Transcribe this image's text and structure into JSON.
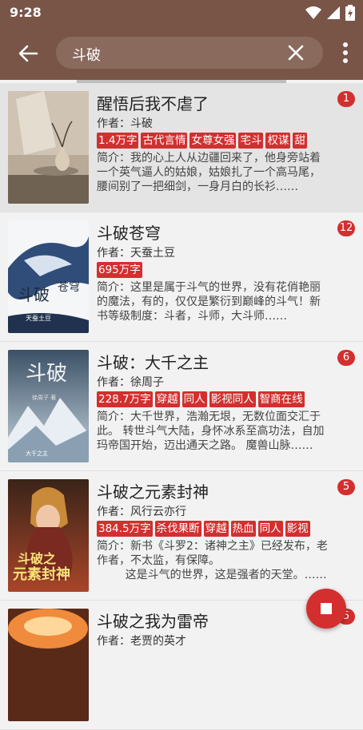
{
  "status": {
    "time": "9:28"
  },
  "search": {
    "query": "斗破"
  },
  "books": [
    {
      "title": "醒悟后我不虐了",
      "author": "作者：斗破",
      "badge": "1",
      "tags": [
        "1.4万字",
        "古代言情",
        "女尊女强",
        "宅斗",
        "权谋",
        "甜"
      ],
      "intro": "简介：我的心上人从边疆回来了，他身旁站着一个英气逼人的姑娘，姑娘扎了一个高马尾，腰间别了一把细剑，一身月白的长衫……"
    },
    {
      "title": "斗破苍穹",
      "author": "作者：天蚕土豆",
      "badge": "12",
      "tags": [
        "695万字"
      ],
      "intro": "简介：这里是属于斗气的世界，没有花俏艳丽的魔法，有的，仅仅是繁衍到巅峰的斗气！新书等级制度：斗者，斗师，大斗师……"
    },
    {
      "title": "斗破：大千之主",
      "author": "作者：徐周子",
      "badge": "6",
      "tags": [
        "228.7万字",
        "穿越",
        "同人",
        "影视同人",
        "智商在线"
      ],
      "intro": "简介：大千世界，浩瀚无垠，无数位面交汇于此。 转世斗气大陆，身怀冰系至高功法，自加玛帝国开始，迈出通天之路。 魔兽山脉……"
    },
    {
      "title": "斗破之元素封神",
      "author": "作者：风行云亦行",
      "badge": "5",
      "tags": [
        "384.5万字",
        "杀伐果断",
        "穿越",
        "热血",
        "同人",
        "影视"
      ],
      "intro": "简介：新书《斗罗2：诸神之主》已经发布，老作者，不太监，有保障。\n        这是斗气的世界，这是强者的天堂。……"
    },
    {
      "title": "斗破之我为雷帝",
      "author": "作者：老贾的英才",
      "badge": "5",
      "tags": [],
      "intro": ""
    }
  ],
  "colors": {
    "primary": "#795548",
    "accent": "#d32f2f"
  },
  "icons": {
    "back": "arrow-left",
    "clear": "close",
    "menu": "more-vertical",
    "fab": "stop-square"
  }
}
